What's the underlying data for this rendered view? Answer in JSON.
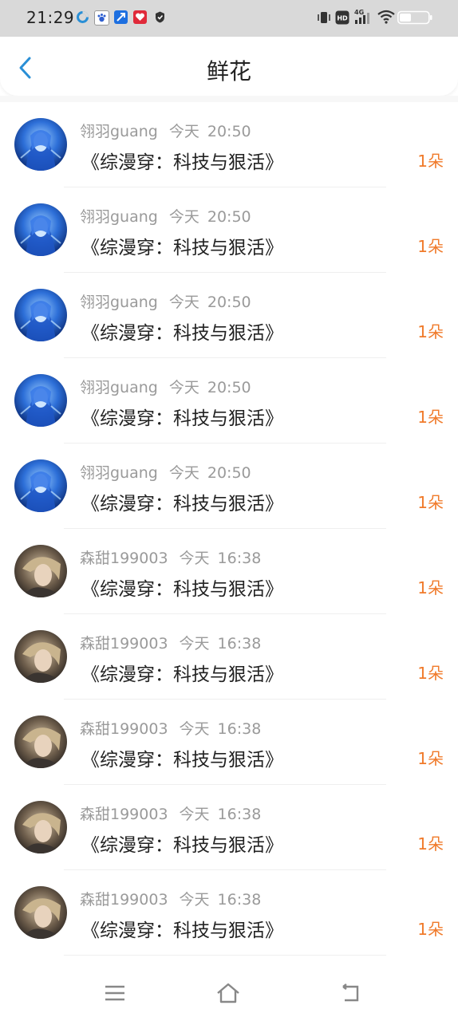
{
  "status_bar": {
    "time": "21:29",
    "left_icons": [
      "loop-app-icon",
      "paw-app-icon",
      "arrow-app-icon",
      "heart-app-icon",
      "shield-app-icon"
    ],
    "right_icons": [
      "vibrate-icon",
      "hd-icon",
      "4g-signal-icon",
      "wifi-icon",
      "battery-icon"
    ],
    "network_label": "4G",
    "hd_label": "HD"
  },
  "header": {
    "title": "鲜花",
    "back_icon": "chevron-left-icon"
  },
  "colors": {
    "accent_blue": "#2a8fd6",
    "count_orange": "#f07a2a",
    "meta_gray": "#9a9a9a",
    "text_dark": "#222222"
  },
  "items": [
    {
      "user": "翎羽guang",
      "day": "今天",
      "time": "20:50",
      "book": "《综漫穿：科技与狠活》",
      "count": "1朵",
      "avatar": "blue"
    },
    {
      "user": "翎羽guang",
      "day": "今天",
      "time": "20:50",
      "book": "《综漫穿：科技与狠活》",
      "count": "1朵",
      "avatar": "blue"
    },
    {
      "user": "翎羽guang",
      "day": "今天",
      "time": "20:50",
      "book": "《综漫穿：科技与狠活》",
      "count": "1朵",
      "avatar": "blue"
    },
    {
      "user": "翎羽guang",
      "day": "今天",
      "time": "20:50",
      "book": "《综漫穿：科技与狠活》",
      "count": "1朵",
      "avatar": "blue"
    },
    {
      "user": "翎羽guang",
      "day": "今天",
      "time": "20:50",
      "book": "《综漫穿：科技与狠活》",
      "count": "1朵",
      "avatar": "blue"
    },
    {
      "user": "森甜199003",
      "day": "今天",
      "time": "16:38",
      "book": "《综漫穿：科技与狠活》",
      "count": "1朵",
      "avatar": "gold"
    },
    {
      "user": "森甜199003",
      "day": "今天",
      "time": "16:38",
      "book": "《综漫穿：科技与狠活》",
      "count": "1朵",
      "avatar": "gold"
    },
    {
      "user": "森甜199003",
      "day": "今天",
      "time": "16:38",
      "book": "《综漫穿：科技与狠活》",
      "count": "1朵",
      "avatar": "gold"
    },
    {
      "user": "森甜199003",
      "day": "今天",
      "time": "16:38",
      "book": "《综漫穿：科技与狠活》",
      "count": "1朵",
      "avatar": "gold"
    },
    {
      "user": "森甜199003",
      "day": "今天",
      "time": "16:38",
      "book": "《综漫穿：科技与狠活》",
      "count": "1朵",
      "avatar": "gold"
    }
  ],
  "nav_bar": {
    "menu_icon": "menu-icon",
    "home_icon": "home-icon",
    "back_icon": "return-icon"
  }
}
